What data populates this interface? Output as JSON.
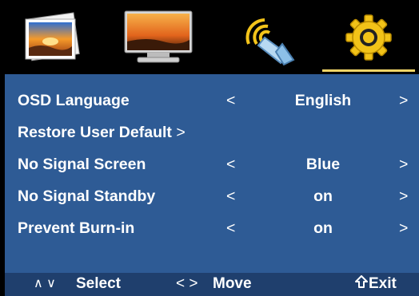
{
  "tabs": [
    {
      "icon": "picture-icon",
      "active": false
    },
    {
      "icon": "monitor-icon",
      "active": false
    },
    {
      "icon": "audio-speaker-icon",
      "active": false
    },
    {
      "icon": "settings-gear-icon",
      "active": true
    }
  ],
  "menu": {
    "rows": [
      {
        "label": "OSD Language",
        "left_arrow": "<",
        "value": "English",
        "right_arrow": ">"
      },
      {
        "label": "Restore User Default",
        "right_arrow": ">"
      },
      {
        "label": "No Signal Screen",
        "left_arrow": "<",
        "value": "Blue",
        "right_arrow": ">"
      },
      {
        "label": "No Signal Standby",
        "left_arrow": "<",
        "value": "on",
        "right_arrow": ">"
      },
      {
        "label": "Prevent Burn-in",
        "left_arrow": "<",
        "value": "on",
        "right_arrow": ">"
      }
    ]
  },
  "footer": {
    "updown": "∧ ∨",
    "select": "Select",
    "leftright": "< >",
    "move": "Move",
    "exit": "Exit"
  },
  "colors": {
    "menu_bg": "#2e5b95",
    "footer_bg": "#1f3f6d",
    "tab_bar_bg": "#000000",
    "active_underline": "#f1d466"
  }
}
